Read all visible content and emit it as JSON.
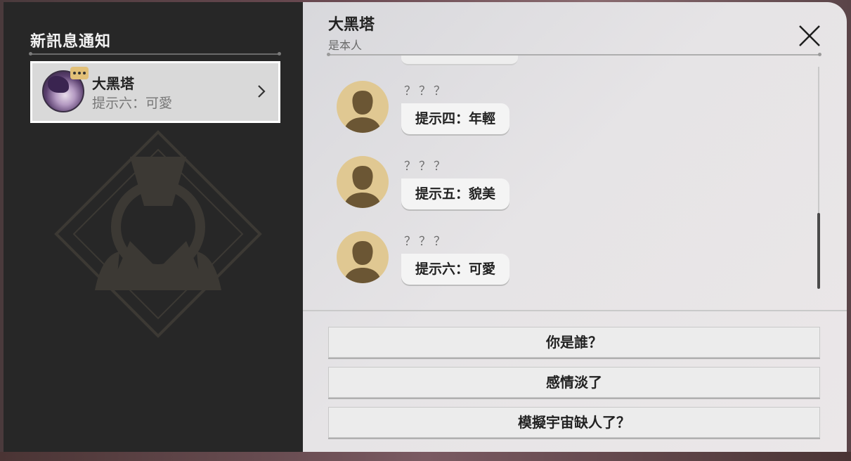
{
  "sidebar": {
    "title": "新訊息通知",
    "contact": {
      "name": "大黑塔",
      "preview": "提示六：可愛",
      "avatar": "herta-avatar",
      "badge_icon": "chat-bubble-icon",
      "chevron_icon": "chevron-right-icon"
    }
  },
  "header": {
    "name": "大黑塔",
    "subtitle": "是本人",
    "close_icon": "close-icon"
  },
  "messages": [
    {
      "sender": "？？？",
      "text": "提示四：年輕",
      "avatar": "silhouette-avatar"
    },
    {
      "sender": "？？？",
      "text": "提示五：貌美",
      "avatar": "silhouette-avatar"
    },
    {
      "sender": "？？？",
      "text": "提示六：可愛",
      "avatar": "silhouette-avatar"
    }
  ],
  "options": [
    {
      "label": "你是誰？"
    },
    {
      "label": "感情淡了"
    },
    {
      "label": "模擬宇宙缺人了？"
    }
  ],
  "colors": {
    "sidebar_bg": "#272727",
    "panel_bg": "#e6e4e6",
    "avatar_bg": "#e0c892",
    "badge": "#e2c078"
  }
}
